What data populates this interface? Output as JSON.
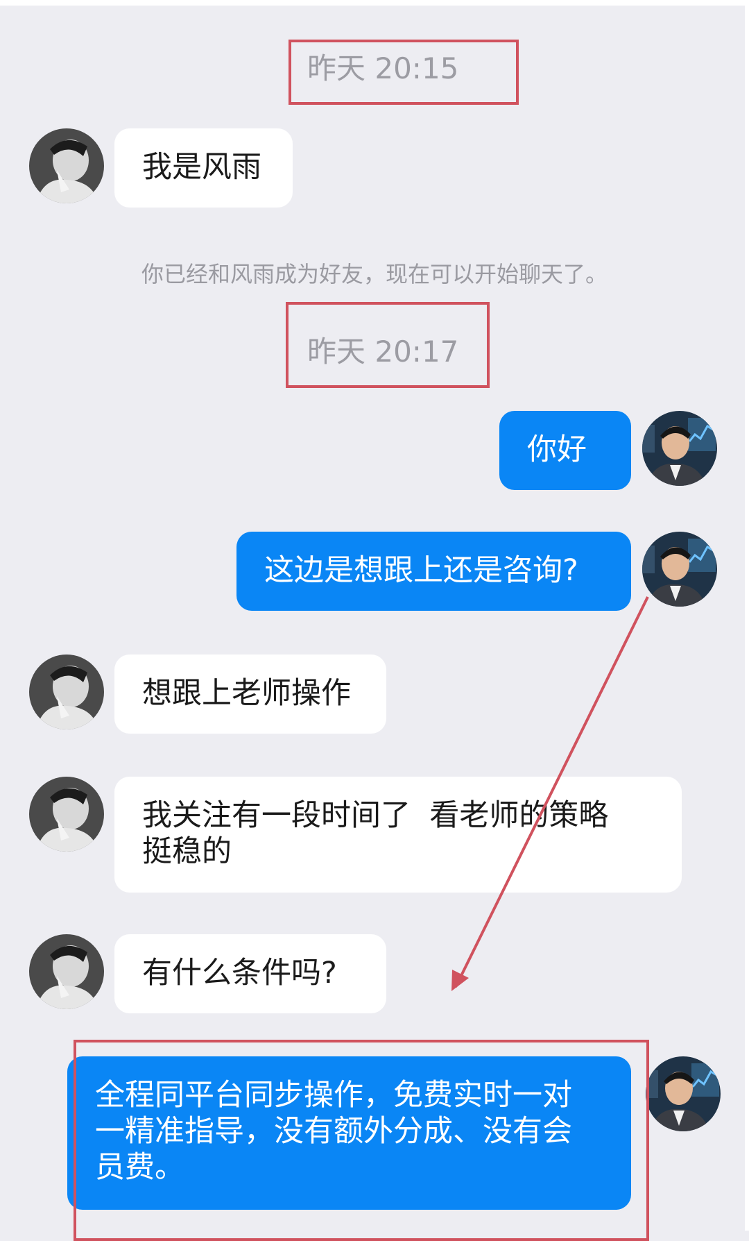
{
  "chat": {
    "timestamp_1": "昨天 20:15",
    "timestamp_2": "昨天 20:17",
    "system_note": "你已经和风雨成为好友，现在可以开始聊天了。",
    "messages": [
      {
        "side": "in",
        "text": "我是风雨"
      },
      {
        "side": "out",
        "text": "你好"
      },
      {
        "side": "out",
        "text": "这边是想跟上还是咨询?"
      },
      {
        "side": "in",
        "text": "想跟上老师操作"
      },
      {
        "side": "in",
        "text": "我关注有一段时间了  看老师的策略\n挺稳的"
      },
      {
        "side": "in",
        "text": "有什么条件吗?"
      },
      {
        "side": "out",
        "text": "全程同平台同步操作，免费实时一对\n一精准指导，没有额外分成、没有会\n员费。"
      }
    ]
  },
  "avatars": {
    "contact": "contact-avatar",
    "self": "self-avatar"
  },
  "colors": {
    "background": "#ededf2",
    "incoming_bubble": "#ffffff",
    "outgoing_bubble": "#0a86f5",
    "annotation": "#d0525e",
    "timestamp_text": "#9c9ca3"
  }
}
